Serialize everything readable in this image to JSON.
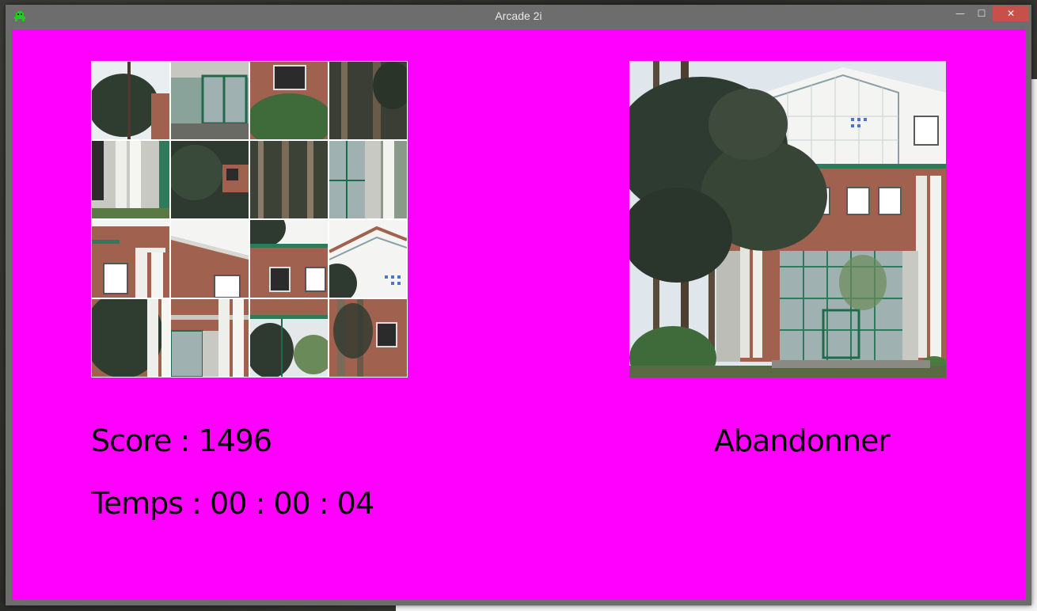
{
  "window": {
    "title": "Arcade 2i",
    "minimize_glyph": "—",
    "maximize_glyph": "☐",
    "close_glyph": "✕",
    "app_icon": "green-alien-icon"
  },
  "game": {
    "score_label": "Score : 1496",
    "time_label": "Temps : 00 : 00 : 04",
    "abandon_label": "Abandonner",
    "background_color": "#ff00ff",
    "grid_size": 4,
    "tiles": [
      "tree-sky",
      "glass-door",
      "shrub-window",
      "trunks",
      "pillars-left",
      "dark-foliage",
      "trunks-dense",
      "glass-wall",
      "pillar-windows",
      "roof-gable",
      "brick-windows",
      "roof-peak",
      "tree-brick",
      "pillar-glass",
      "foliage-sky",
      "trunk-brick"
    ],
    "reference_image": "building-photo"
  }
}
